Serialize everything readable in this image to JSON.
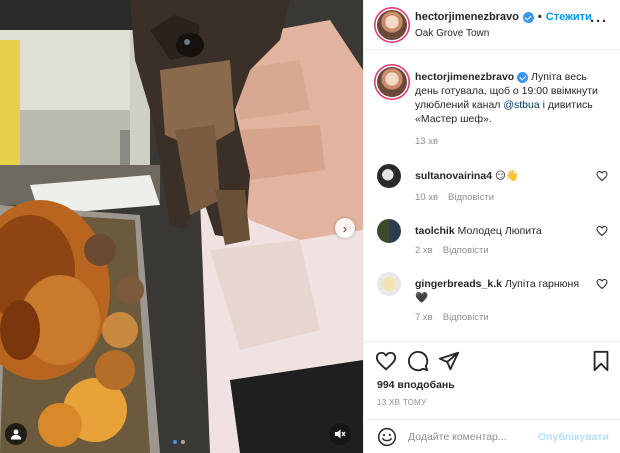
{
  "post": {
    "username": "hectorjimenezbravo",
    "follow_label": "Стежити",
    "location": "Oak Grove Town",
    "more_icon": "more-horizontal-icon"
  },
  "caption": {
    "username": "hectorjimenezbravo",
    "text_before": " Лупіта весь день готувала, щоб о 19:00 ввімкнути улюблений канал ",
    "mention": "@stbua",
    "text_after": " і дивитись «Мастер шеф».",
    "time": "13 хв"
  },
  "comments": [
    {
      "username": "sultanovairina4",
      "text": " 😏👋",
      "time": "10 хв",
      "reply_label": "Відповісти"
    },
    {
      "username": "taolchik",
      "text": " Молодец Люпита",
      "time": "2 хв",
      "reply_label": "Відповісти"
    },
    {
      "username": "gingerbreads_k.k",
      "text": " Лупіта гарнюня🖤",
      "time": "7 хв",
      "reply_label": "Відповісти"
    }
  ],
  "actions": {
    "likes": "994 вподобань",
    "ago": "13 ХВ ТОМУ"
  },
  "composer": {
    "placeholder": "Додайте коментар...",
    "post_label": "Опублікувати"
  },
  "media": {
    "carousel_count": 2,
    "carousel_active": 0
  },
  "colors": {
    "accent": "#0095f6",
    "verified": "#3897f0",
    "muted": "#8e8e8e",
    "post_disabled": "#b2dffc"
  }
}
